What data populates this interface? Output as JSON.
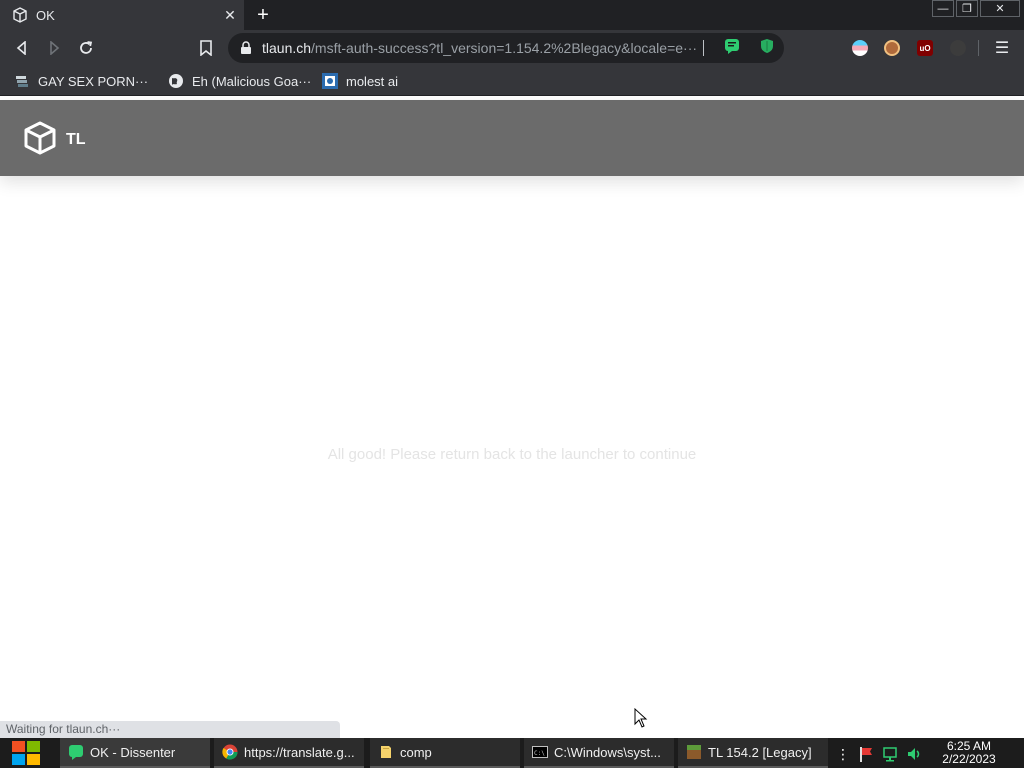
{
  "browser": {
    "tab": {
      "title": "OK",
      "close_symbol": "✕"
    },
    "new_tab_symbol": "+",
    "window_controls": {
      "minimize": "—",
      "restore": "❐",
      "close": "✕"
    },
    "address": {
      "host": "tlaun.ch",
      "path": "/msft-auth-success?tl_version=1.154.2%2Blegacy&locale=e···"
    },
    "menu_symbol": "☰"
  },
  "bookmarks": [
    {
      "label": "GAY SEX PORN···"
    },
    {
      "label": "Eh (Malicious Goa···"
    },
    {
      "label": "molest ai"
    }
  ],
  "page": {
    "brand": "TL",
    "message": "All good! Please return back to the launcher to continue",
    "status": "Waiting for tlaun.ch···"
  },
  "taskbar": {
    "items": [
      {
        "label": "OK - Dissenter"
      },
      {
        "label": "https://translate.g..."
      },
      {
        "label": "comp"
      },
      {
        "label": "C:\\Windows\\syst..."
      },
      {
        "label": "TL 154.2 [Legacy]"
      }
    ],
    "clock": {
      "time": "6:25 AM",
      "date": "2/22/2023"
    }
  },
  "colors": {
    "browser_dark": "#202124",
    "toolbar": "#35363a",
    "header_gray": "#6b6b6b",
    "dissenter_green": "#2ecc71",
    "taskbar": "#1c1c1c"
  }
}
